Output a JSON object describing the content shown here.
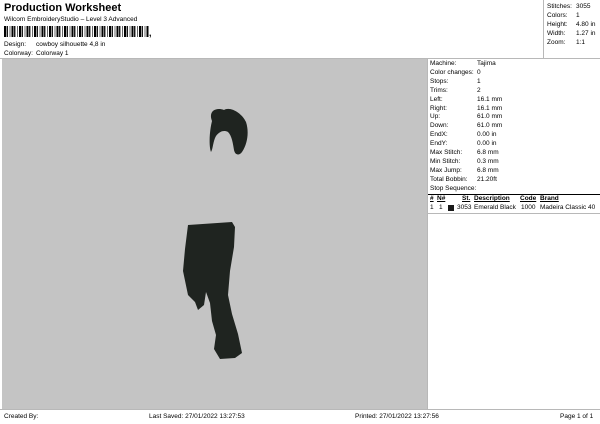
{
  "header": {
    "title": "Production Worksheet",
    "subtitle": "Wilcom EmbroideryStudio – Level 3 Advanced",
    "barcode_suffix": ","
  },
  "meta": {
    "design_label": "Design:",
    "design_value": "cowboy silhouette 4,8 in",
    "colorway_label": "Colorway:",
    "colorway_value": "Colorway 1"
  },
  "stats": {
    "stitches_label": "Stitches:",
    "stitches_value": "3055",
    "colors_label": "Colors:",
    "colors_value": "1",
    "height_label": "Height:",
    "height_value": "4.80 in",
    "width_label": "Width:",
    "width_value": "1.27 in",
    "zoom_label": "Zoom:",
    "zoom_value": "1:1"
  },
  "machine_info": [
    {
      "label": "Machine:",
      "value": "Tajima"
    },
    {
      "label": "Color changes:",
      "value": "0"
    },
    {
      "label": "Stops:",
      "value": "1"
    },
    {
      "label": "Trims:",
      "value": "2"
    },
    {
      "label": "Left:",
      "value": "16.1 mm"
    },
    {
      "label": "Right:",
      "value": "16.1 mm"
    },
    {
      "label": "Up:",
      "value": "61.0 mm"
    },
    {
      "label": "Down:",
      "value": "61.0 mm"
    },
    {
      "label": "EndX:",
      "value": "0.00 in"
    },
    {
      "label": "EndY:",
      "value": "0.00 in"
    },
    {
      "label": "Max Stitch:",
      "value": "6.8 mm"
    },
    {
      "label": "Min Stitch:",
      "value": "0.3 mm"
    },
    {
      "label": "Max Jump:",
      "value": "6.8 mm"
    },
    {
      "label": "Total Bobbin:",
      "value": "21.20ft"
    }
  ],
  "stop_sequence": {
    "title": "Stop Sequence:",
    "headers": {
      "num": "#",
      "n": "N#",
      "st": "St.",
      "desc": "Description",
      "code": "Code",
      "brand": "Brand"
    },
    "rows": [
      {
        "num": "1",
        "n": "1",
        "swatch_color": "#1a1a1a",
        "st": "3053",
        "desc": "Emerald Black",
        "code": "1000",
        "brand": "Madeira Classic 40"
      }
    ]
  },
  "footer": {
    "created_by": "Created By:",
    "last_saved": "Last Saved: 27/01/2022 13:27:53",
    "printed": "Printed: 27/01/2022 13:27:56",
    "page": "Page 1 of 1"
  },
  "colors": {
    "canvas_bg": "#c4c4c4",
    "thread": "#1f2420"
  }
}
